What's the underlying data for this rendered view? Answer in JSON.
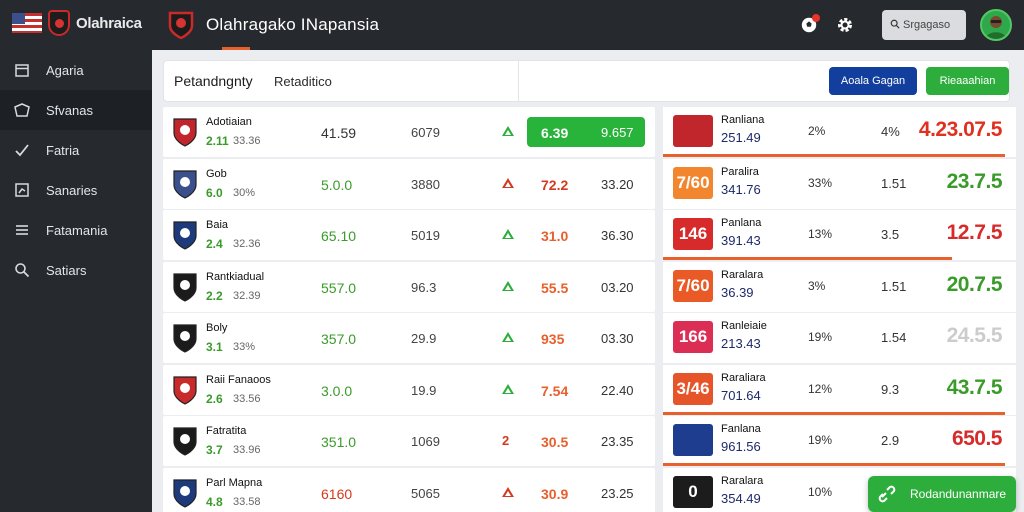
{
  "brand": {
    "name": "Olahraica"
  },
  "topbar": {
    "title": "Olahragako INapansia",
    "search_placeholder": "Srgagaso"
  },
  "sidebar": {
    "items": [
      {
        "label": "Agaria",
        "icon": "calendar-icon"
      },
      {
        "label": "Sfvanas",
        "icon": "stadium-icon"
      },
      {
        "label": "Fatria",
        "icon": "check-icon"
      },
      {
        "label": "Sanaries",
        "icon": "chart-icon"
      },
      {
        "label": "Fatamania",
        "icon": "list-icon"
      },
      {
        "label": "Satiars",
        "icon": "search-icon"
      }
    ]
  },
  "tabs": {
    "active": "Petandngnty",
    "second": "Retaditico"
  },
  "buttons": {
    "blue": "Aoala Gagan",
    "green": "Rieaaahian"
  },
  "left_rows": [
    {
      "name": "Adotiaian",
      "rating": "2.11",
      "sub": "33.36",
      "c1": "41.59",
      "c2": "6079",
      "c3": "6.39",
      "c4": "9.657",
      "c1_color": "#333333",
      "c3_color": "#ffffff",
      "arrow": "up",
      "highlight": true
    },
    {
      "name": "Gob",
      "rating": "6.0",
      "sub": "30%",
      "c1": "5.0.0",
      "c2": "3880",
      "c3": "72.2",
      "c4": "33.20",
      "c1_color": "#3a9b2a",
      "c3_color": "#d23b1f",
      "arrow": "up-red",
      "highlight": false
    },
    {
      "name": "Baia",
      "rating": "2.4",
      "sub": "32.36",
      "c1": "65.10",
      "c2": "5019",
      "c3": "31.0",
      "c4": "36.30",
      "c1_color": "#3a9b2a",
      "c3_color": "#e8602c",
      "arrow": "up",
      "highlight": false
    },
    {
      "name": "Rantkiadual",
      "rating": "2.2",
      "sub": "32.39",
      "c1": "557.0",
      "c2": "96.3",
      "c3": "55.5",
      "c4": "03.20",
      "c1_color": "#3a9b2a",
      "c3_color": "#e8602c",
      "arrow": "up",
      "highlight": false
    },
    {
      "name": "Boly",
      "rating": "3.1",
      "sub": "33%",
      "c1": "357.0",
      "c2": "29.9",
      "c3": "935",
      "c4": "03.30",
      "c1_color": "#3a9b2a",
      "c3_color": "#e8602c",
      "arrow": "up",
      "highlight": false
    },
    {
      "name": "Raii Fanaoos",
      "rating": "2.6",
      "sub": "33.56",
      "c1": "3.0.0",
      "c2": "19.9",
      "c3": "7.54",
      "c4": "22.40",
      "c1_color": "#3a9b2a",
      "c3_color": "#e8602c",
      "arrow": "up",
      "highlight": false
    },
    {
      "name": "Fatratita",
      "rating": "3.7",
      "sub": "33.96",
      "c1": "351.0",
      "c2": "1069",
      "c3": "30.5",
      "c4": "23.35",
      "c1_color": "#3a9b2a",
      "c3_color": "#e8602c",
      "arrow": "num-red",
      "highlight": false
    },
    {
      "name": "Parl Mapna",
      "rating": "4.8",
      "sub": "33.58",
      "c1": "6160",
      "c2": "5065",
      "c3": "30.9",
      "c4": "23.25",
      "c1_color": "#d23b1f",
      "c3_color": "#e8602c",
      "arrow": "up-red",
      "highlight": false
    }
  ],
  "right_rows": [
    {
      "tile_text": "",
      "tile_color": "#c0262c",
      "name": "Ranliana",
      "value": "251.49",
      "pct": "2%",
      "num": "4%",
      "big": "4.23.07.5",
      "big_color": "#e0301f",
      "bar_fraction": 0.97
    },
    {
      "tile_text": "7/60",
      "tile_color": "#f2862f",
      "name": "Paralira",
      "value": "341.76",
      "pct": "33%",
      "num": "1.51",
      "big": "23.7.5",
      "big_color": "#3a9b2a",
      "bar_fraction": 0.0
    },
    {
      "tile_text": "146",
      "tile_color": "#d72b2b",
      "name": "Panlana",
      "value": "391.43",
      "pct": "13%",
      "num": "3.5",
      "big": "12.7.5",
      "big_color": "#d72b2b",
      "bar_fraction": 0.82
    },
    {
      "tile_text": "7/60",
      "tile_color": "#ea5a26",
      "name": "Raralara",
      "value": "36.39",
      "pct": "3%",
      "num": "1.51",
      "big": "20.7.5",
      "big_color": "#3a9b2a",
      "bar_fraction": 0.0
    },
    {
      "tile_text": "166",
      "tile_color": "#dc2d55",
      "name": "Ranleiaie",
      "value": "213.43",
      "pct": "19%",
      "num": "1.54",
      "big": "24.5.5",
      "big_color": "#cccccc",
      "bar_fraction": 0.0
    },
    {
      "tile_text": "3/46",
      "tile_color": "#e6552a",
      "name": "Raraliara",
      "value": "701.64",
      "pct": "12%",
      "num": "9.3",
      "big": "43.7.5",
      "big_color": "#3a9b2a",
      "bar_fraction": 0.97
    },
    {
      "tile_text": "",
      "tile_color": "#1f3d8f",
      "name": "Fanlana",
      "value": "961.56",
      "pct": "19%",
      "num": "2.9",
      "big": "650.5",
      "big_color": "#d72b2b",
      "bar_fraction": 0.97
    },
    {
      "tile_text": "0",
      "tile_color": "#1c1c1c",
      "name": "Raralara",
      "value": "354.49",
      "pct": "10%",
      "num": "",
      "big": "",
      "big_color": "#3a9b2a",
      "bar_fraction": 0.0
    }
  ],
  "float_button": {
    "label": "Rodandunanmare"
  }
}
